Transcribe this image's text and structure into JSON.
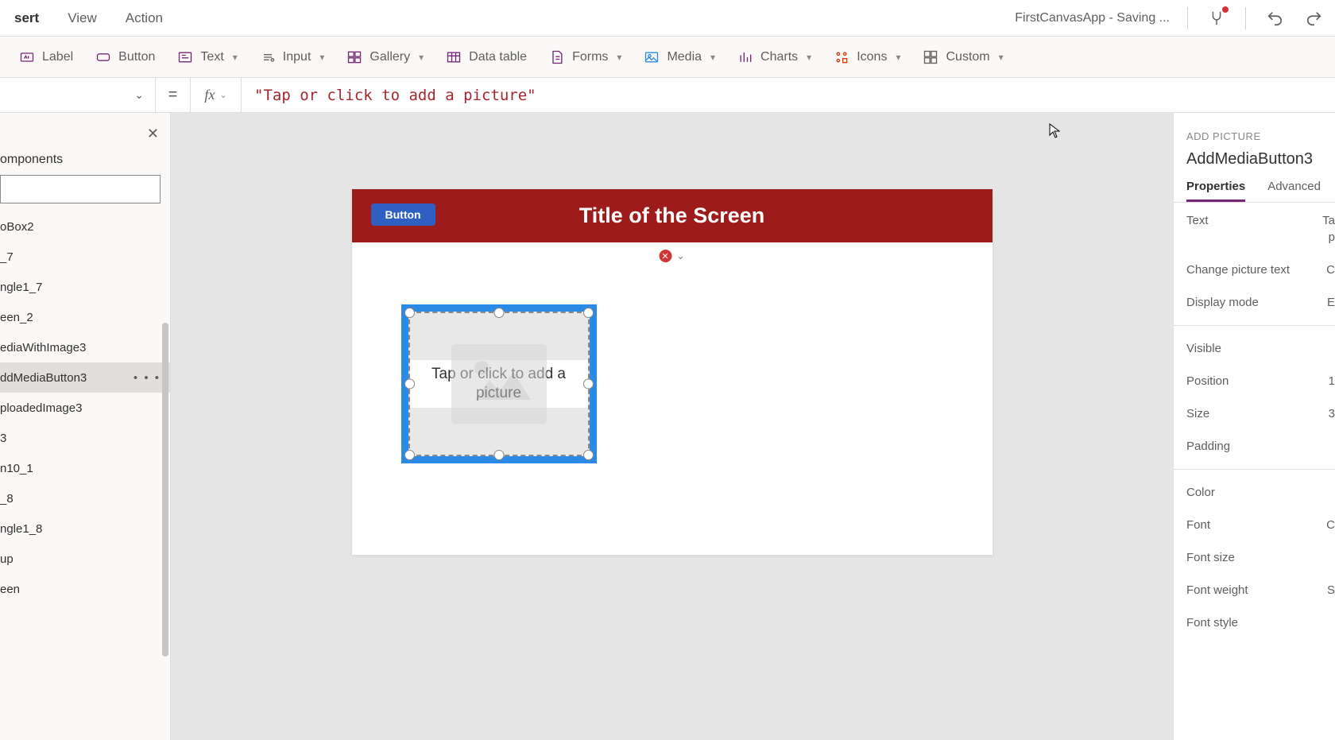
{
  "header": {
    "tabs": [
      "sert",
      "View",
      "Action"
    ],
    "active_tab_index": 0,
    "status_text": "FirstCanvasApp - Saving ..."
  },
  "ribbon": {
    "items": [
      {
        "label": "Label",
        "icon": "label-icon",
        "dropdown": false
      },
      {
        "label": "Button",
        "icon": "button-icon",
        "dropdown": false
      },
      {
        "label": "Text",
        "icon": "text-icon",
        "dropdown": true
      },
      {
        "label": "Input",
        "icon": "input-icon",
        "dropdown": true
      },
      {
        "label": "Gallery",
        "icon": "gallery-icon",
        "dropdown": true
      },
      {
        "label": "Data table",
        "icon": "datatable-icon",
        "dropdown": false
      },
      {
        "label": "Forms",
        "icon": "forms-icon",
        "dropdown": true
      },
      {
        "label": "Media",
        "icon": "media-icon",
        "dropdown": true
      },
      {
        "label": "Charts",
        "icon": "charts-icon",
        "dropdown": true
      },
      {
        "label": "Icons",
        "icon": "icons-icon",
        "dropdown": true
      },
      {
        "label": "Custom",
        "icon": "custom-icon",
        "dropdown": true
      }
    ]
  },
  "formula": {
    "eq": "=",
    "fx": "fx",
    "value": "\"Tap or click to add a picture\""
  },
  "left": {
    "title": "omponents",
    "items": [
      "oBox2",
      "_7",
      "ngle1_7",
      "een_2",
      "ediaWithImage3",
      "ddMediaButton3",
      "ploadedImage3",
      "3",
      "n10_1",
      "_8",
      "ngle1_8",
      "up",
      "een"
    ],
    "selected_index": 5
  },
  "canvas": {
    "screen_title": "Title of the Screen",
    "header_button": "Button",
    "media_text": "Tap or click to add a picture",
    "error_glyph": "✕"
  },
  "right": {
    "type_label": "ADD PICTURE",
    "control_name": "AddMediaButton3",
    "tabs": [
      "Properties",
      "Advanced"
    ],
    "active_tab_index": 0,
    "props": [
      {
        "label": "Text",
        "value": "Ta"
      },
      {
        "label": "",
        "value": "p"
      },
      {
        "label": "Change picture text",
        "value": "C"
      },
      {
        "label": "Display mode",
        "value": "E"
      }
    ],
    "props2": [
      {
        "label": "Visible",
        "value": ""
      },
      {
        "label": "Position",
        "value": "1"
      },
      {
        "label": "Size",
        "value": "3"
      },
      {
        "label": "Padding",
        "value": ""
      }
    ],
    "props3": [
      {
        "label": "Color",
        "value": ""
      },
      {
        "label": "Font",
        "value": "C"
      },
      {
        "label": "Font size",
        "value": ""
      },
      {
        "label": "Font weight",
        "value": "S"
      },
      {
        "label": "Font style",
        "value": ""
      }
    ]
  }
}
